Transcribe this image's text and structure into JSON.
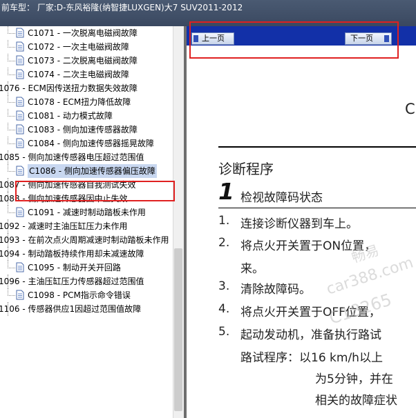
{
  "title": "前车型：  厂家:D-东风裕隆(纳智捷LUXGEN)大7 SUV2011-2012",
  "tree": [
    {
      "label": "C1071 - 一次脱离电磁阀故障",
      "indent": 2
    },
    {
      "label": "C1072 - 一次主电磁阀故障",
      "indent": 2
    },
    {
      "label": "C1073 - 二次脱离电磁阀故障",
      "indent": 2
    },
    {
      "label": "C1074 - 二次主电磁阀故障",
      "indent": 2
    },
    {
      "label": "1076 - ECM因传送扭力数据失效故障",
      "indent": 1
    },
    {
      "label": "C1078 - ECM扭力降低故障",
      "indent": 2
    },
    {
      "label": "C1081 - 动力模式故障",
      "indent": 2
    },
    {
      "label": "C1083 - 侧向加速传感器故障",
      "indent": 2
    },
    {
      "label": "C1084 - 侧向加速传感器摇晃故障",
      "indent": 2
    },
    {
      "label": "1085 - 侧向加速传感器电压超过范围值",
      "indent": 1
    },
    {
      "label": "C1086 - 侧向加速传感器偏压故障",
      "indent": 2,
      "selected": true
    },
    {
      "label": "1087 - 侧向加速传感器自我测试失效",
      "indent": 1
    },
    {
      "label": "1088 - 侧向加速传感器因中止失效",
      "indent": 1
    },
    {
      "label": "C1091 - 减速时制动踏板未作用",
      "indent": 2
    },
    {
      "label": "1092 - 减速时主油压缸压力未作用",
      "indent": 1
    },
    {
      "label": "1093 - 在前次点火周期减速时制动踏板未作用",
      "indent": 1
    },
    {
      "label": "1094 - 制动踏板持续作用却未减速故障",
      "indent": 1
    },
    {
      "label": "C1095 - 制动开关开回路",
      "indent": 2
    },
    {
      "label": "1096 - 主油压缸压力传感器超过范围值",
      "indent": 1
    },
    {
      "label": "C1098 - PCM指示命令错误",
      "indent": 2
    },
    {
      "label": "1106 - 传感器供应1因超过范围值故障",
      "indent": 1
    }
  ],
  "nav": {
    "prev_label": "上一页",
    "next_label": "下一页"
  },
  "doc": {
    "header_partial": "C",
    "section_title": "诊断程序",
    "step_number": "1",
    "step_title": "检视故障码状态",
    "items": [
      {
        "num": "1.",
        "text": "连接诊断仪器到车上。"
      },
      {
        "num": "2.",
        "text": "将点火开关置于ON位置，"
      },
      {
        "num": "",
        "text": "来。"
      },
      {
        "num": "3.",
        "text": "清除故障码。"
      },
      {
        "num": "4.",
        "text": "将点火开关置于OFF位置，"
      },
      {
        "num": "5.",
        "text": "起动发动机，准备执行路试"
      },
      {
        "num": "",
        "text": "路试程序：以16 km/h以上"
      },
      {
        "num": "",
        "text": "为5分钟，并在"
      },
      {
        "num": "",
        "text": "相关的故障症状"
      }
    ],
    "watermark_lines": [
      "畅易",
      "car388.com",
      "C18265"
    ]
  },
  "colors": {
    "highlight": "#e02020",
    "nav_bg": "#1230a8",
    "selected_bg": "#c8d7f0"
  }
}
